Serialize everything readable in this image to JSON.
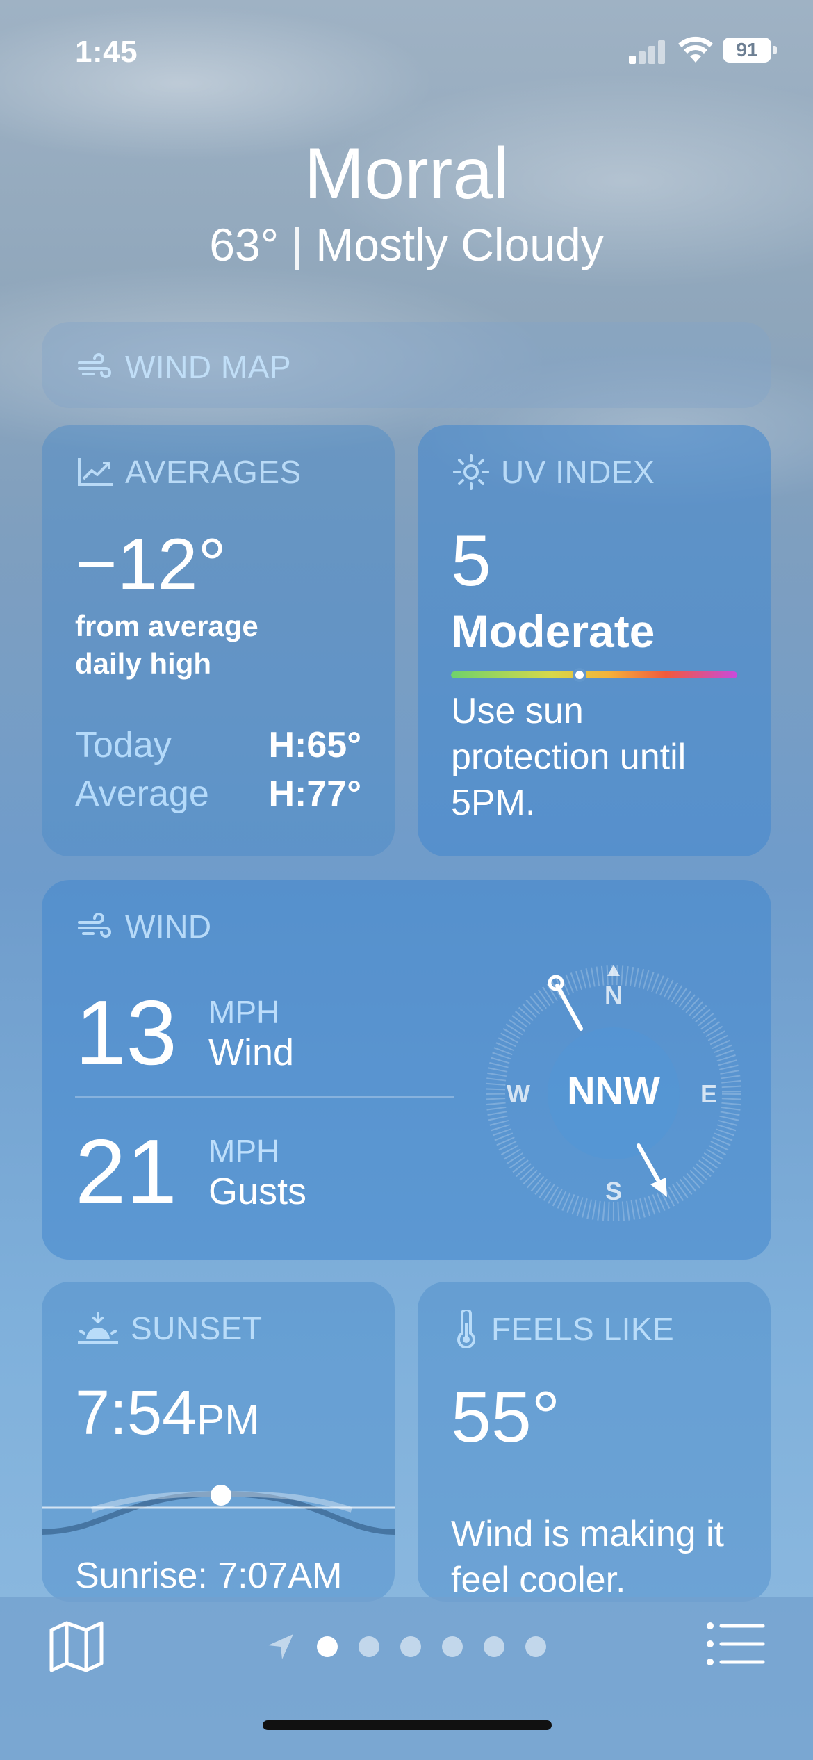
{
  "status": {
    "time": "1:45",
    "battery": "91"
  },
  "location": {
    "city": "Morral",
    "temperature": "63°",
    "separator": "|",
    "condition": "Mostly Cloudy"
  },
  "wind_map": {
    "title": "WIND MAP"
  },
  "averages": {
    "title": "AVERAGES",
    "difference": "−12°",
    "subtitle_line1": "from average",
    "subtitle_line2": "daily high",
    "today_label": "Today",
    "today_value": "H:65°",
    "average_label": "Average",
    "average_value": "H:77°"
  },
  "uv_index": {
    "title": "UV INDEX",
    "value": "5",
    "level": "Moderate",
    "level_fraction": 0.45,
    "description": "Use sun protection until 5PM."
  },
  "wind": {
    "title": "WIND",
    "speed": "13",
    "speed_unit": "MPH",
    "speed_label": "Wind",
    "gusts": "21",
    "gusts_unit": "MPH",
    "gusts_label": "Gusts",
    "direction": "NNW",
    "compass": {
      "n": "N",
      "e": "E",
      "s": "S",
      "w": "W"
    }
  },
  "sunset": {
    "title": "SUNSET",
    "time": "7:54",
    "time_suffix": "PM",
    "sunrise": "Sunrise: 7:07AM"
  },
  "feels_like": {
    "title": "FEELS LIKE",
    "value": "55°",
    "description": "Wind is making it feel cooler."
  },
  "pager": {
    "pages": 6,
    "active_index": 0
  },
  "icons": {
    "map": "map-icon",
    "list": "list-icon",
    "location": "location-arrow-icon",
    "wind": "wind-icon",
    "averages": "chart-up-icon",
    "uv": "sun-icon",
    "sunset": "sunset-icon",
    "thermometer": "thermometer-icon"
  }
}
